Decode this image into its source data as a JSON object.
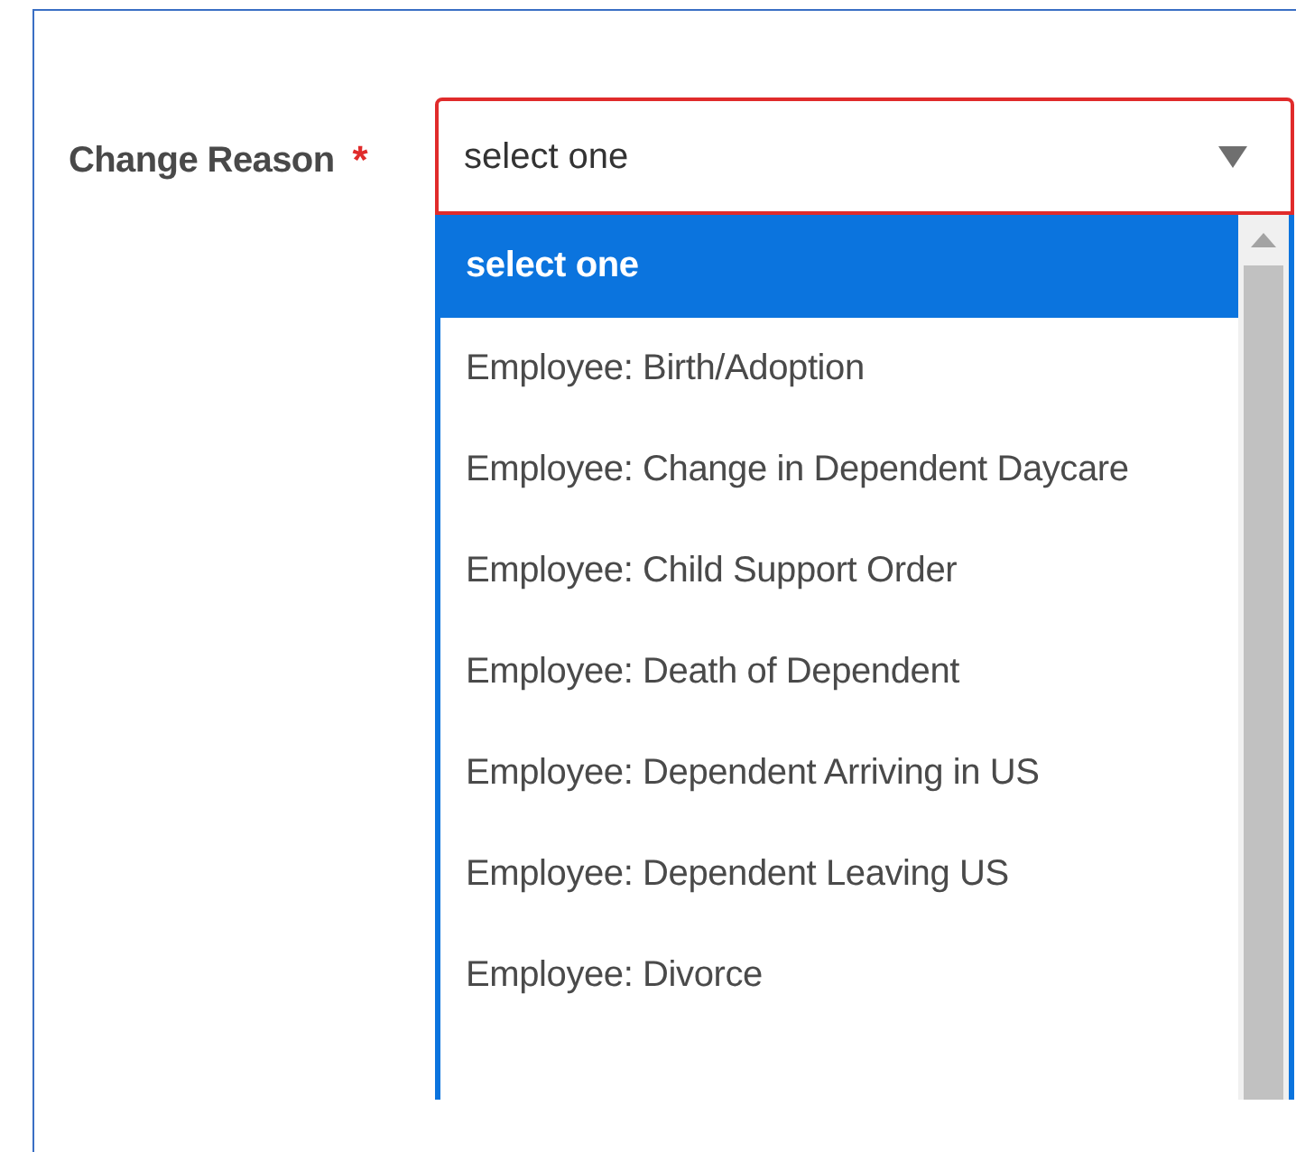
{
  "field": {
    "label": "Change Reason",
    "required_mark": "*",
    "value": "select one"
  },
  "options": [
    {
      "label": "select one",
      "selected": true
    },
    {
      "label": "Employee: Birth/Adoption",
      "selected": false
    },
    {
      "label": "Employee: Change in Dependent Daycare",
      "selected": false
    },
    {
      "label": "Employee: Child Support Order",
      "selected": false
    },
    {
      "label": "Employee: Death of Dependent",
      "selected": false
    },
    {
      "label": "Employee: Dependent Arriving in US",
      "selected": false
    },
    {
      "label": "Employee: Dependent Leaving US",
      "selected": false
    },
    {
      "label": "Employee: Divorce",
      "selected": false
    }
  ]
}
